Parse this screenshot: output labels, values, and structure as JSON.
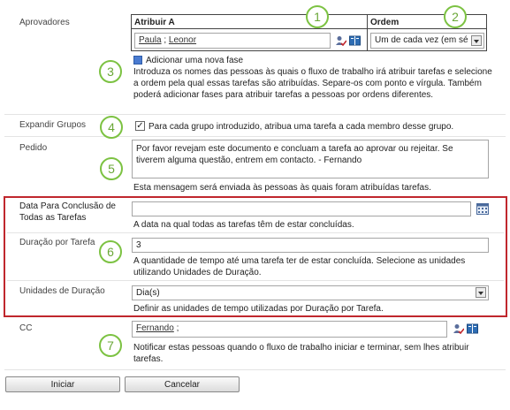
{
  "approvers": {
    "label": "Aprovadores",
    "col_assign": "Atribuir A",
    "col_order": "Ordem",
    "assignees": "Paula ; Leonor",
    "assignee_1": "Paula",
    "assignee_2": "Leonor",
    "assignee_sep": " ; ",
    "order_value": "Um de cada vez (em sé",
    "add_stage": "Adicionar uma nova fase",
    "description": "Introduza os nomes das pessoas às quais o fluxo de trabalho irá atribuir tarefas e selecione a ordem pela qual essas tarefas são atribuídas. Separe-os com ponto e vírgula. Também poderá adicionar fases para atribuir tarefas a pessoas por ordens diferentes."
  },
  "expand_groups": {
    "label": "Expandir Grupos",
    "checkbox_text": "Para cada grupo introduzido, atribua uma tarefa a cada membro desse grupo.",
    "checked": true
  },
  "request": {
    "label": "Pedido",
    "value": "Por favor revejam este documento e concluam a tarefa ao aprovar ou rejeitar. Se tiverem alguma questão, entrem em contacto. - Fernando",
    "description": "Esta mensagem será enviada às pessoas às quais foram atribuídas tarefas."
  },
  "due_date": {
    "label": "Data Para Conclusão de Todas as Tarefas",
    "description": "A data na qual todas as tarefas têm de estar concluídas."
  },
  "duration": {
    "label": "Duração por Tarefa",
    "value": "3",
    "description": "A quantidade de tempo até uma tarefa ter de estar concluída. Selecione as unidades utilizando Unidades de Duração."
  },
  "duration_units": {
    "label": "Unidades de Duração",
    "value": "Dia(s)",
    "description": "Definir as unidades de tempo utilizadas por Duração por Tarefa."
  },
  "cc": {
    "label": "CC",
    "value_name": "Fernando",
    "value_suffix": " ;",
    "description": "Notificar estas pessoas quando o fluxo de trabalho iniciar e terminar, sem lhes atribuir tarefas."
  },
  "buttons": {
    "start": "Iniciar",
    "cancel": "Cancelar"
  },
  "callouts": [
    "1",
    "2",
    "3",
    "4",
    "5",
    "6",
    "7"
  ],
  "colors": {
    "callout": "#7cc242",
    "highlight_border": "#c0272d"
  }
}
